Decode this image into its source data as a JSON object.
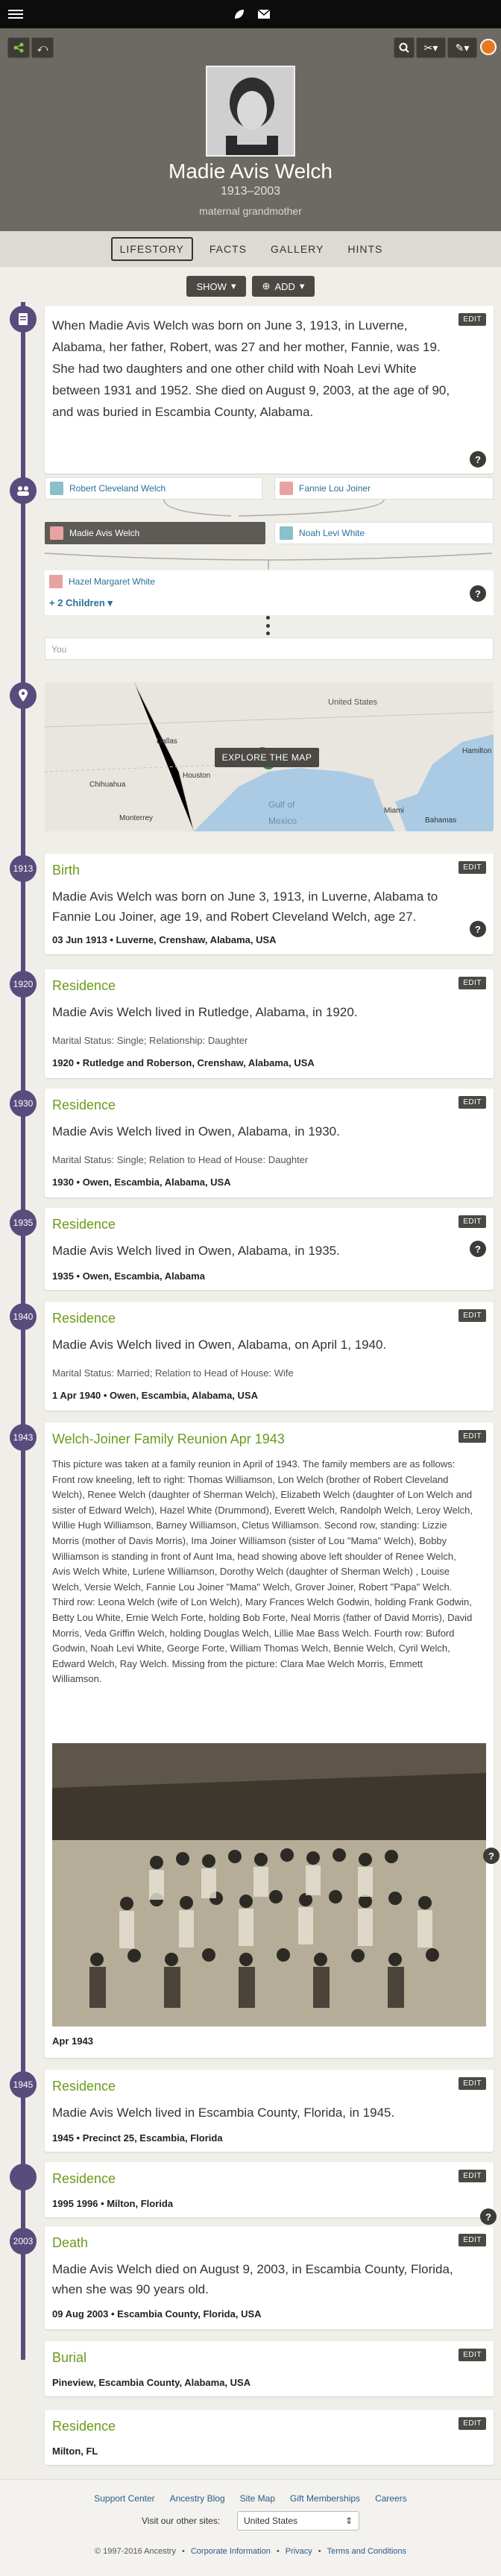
{
  "person": {
    "name": "Madie Avis Welch",
    "lifespan": "1913–2003",
    "relation": "maternal grandmother"
  },
  "tabs": [
    "LIFESTORY",
    "FACTS",
    "GALLERY",
    "HINTS"
  ],
  "actions": {
    "show": "SHOW",
    "add": "ADD"
  },
  "story": "When Madie Avis Welch was born on June 3, 1913, in Luverne, Alabama, her father, Robert, was 27 and her mother, Fannie, was 19. She had two daughters and one other child with Noah Levi White between 1931 and 1952. She died on August 9, 2003, at the age of 90, and was buried in Escambia County, Alabama.",
  "family": {
    "father": "Robert Cleveland Welch",
    "mother": "Fannie Lou Joiner",
    "self": "Madie Avis Welch",
    "spouse": "Noah Levi White",
    "child": "Hazel Margaret White",
    "more_children": "+ 2 Children",
    "you": "You"
  },
  "map": {
    "explore": "EXPLORE THE MAP",
    "labels": [
      "Dallas",
      "Houston",
      "Monterrey",
      "Chihuahua",
      "Hamilton",
      "Bahamas",
      "Gulf of",
      "Mexico",
      "United States",
      "Miami"
    ]
  },
  "edit_label": "EDIT",
  "events": [
    {
      "year": "1913",
      "title": "Birth",
      "sentence": "Madie Avis Welch was born on June 3, 1913, in Luverne, Alabama to Fannie Lou Joiner, age 19, and Robert Cleveland Welch, age 27.",
      "meta": "",
      "footer": "03 Jun 1913 • Luverne, Crenshaw, Alabama, USA"
    },
    {
      "year": "1920",
      "title": "Residence",
      "sentence": "Madie Avis Welch lived in Rutledge, Alabama, in 1920.",
      "meta": "Marital Status: Single; Relationship: Daughter",
      "footer": "1920 • Rutledge and Roberson, Crenshaw, Alabama, USA"
    },
    {
      "year": "1930",
      "title": "Residence",
      "sentence": "Madie Avis Welch lived in Owen, Alabama, in 1930.",
      "meta": "Marital Status: Single; Relation to Head of House: Daughter",
      "footer": "1930 • Owen, Escambia, Alabama, USA"
    },
    {
      "year": "1935",
      "title": "Residence",
      "sentence": "Madie Avis Welch lived in Owen, Alabama, in 1935.",
      "meta": "",
      "footer": "1935 • Owen, Escambia, Alabama"
    },
    {
      "year": "1940",
      "title": "Residence",
      "sentence": "Madie Avis Welch lived in Owen, Alabama, on April 1, 1940.",
      "meta": "Marital Status: Married; Relation to Head of House: Wife",
      "footer": "1 Apr 1940 • Owen, Escambia, Alabama, USA"
    }
  ],
  "reunion": {
    "year": "1943",
    "title": "Welch-Joiner Family Reunion Apr 1943",
    "description": "This picture was taken at a family reunion in April of 1943. The family members are as follows: Front row kneeling, left to right: Thomas Williamson, Lon Welch (brother of Robert Cleveland Welch), Renee Welch (daughter of Sherman Welch), Elizabeth Welch (daughter of Lon Welch and sister of Edward Welch), Hazel White (Drummond), Everett Welch, Randolph Welch, Leroy Welch, Willie Hugh Williamson, Barney Williamson, Cletus Williamson. Second row, standing: Lizzie Morris (mother of Davis Morris), Ima Joiner Williamson (sister of Lou \"Mama\" Welch), Bobby Williamson is standing in front of Aunt Ima, head showing above left shoulder of Renee Welch, Avis Welch White, Lurlene Williamson, Dorothy Welch (daughter of Sherman Welch) , Louise Welch, Versie Welch, Fannie Lou Joiner \"Mama\" Welch, Grover Joiner, Robert \"Papa\" Welch. Third row: Leona Welch (wife of Lon Welch), Mary Frances Welch Godwin, holding Frank Godwin, Betty Lou White, Ernie Welch Forte, holding Bob Forte, Neal Morris (father of David Morris), David Morris, Veda Griffin Welch, holding Douglas Welch, Lillie Mae Bass Welch. Fourth row: Buford Godwin, Noah Levi White, George Forte, William Thomas Welch, Bennie Welch, Cyril Welch, Edward Welch, Ray Welch. Missing from the picture: Clara Mae Welch Morris, Emmett Williamson.",
    "caption": "Apr 1943"
  },
  "events2": [
    {
      "year": "1945",
      "title": "Residence",
      "sentence": "Madie Avis Welch lived in Escambia County, Florida, in 1945.",
      "footer": "1945 • Precinct 25, Escambia, Florida"
    },
    {
      "year": "",
      "title": "Residence",
      "sentence": "",
      "footer": "1995 1996 • Milton, Florida"
    },
    {
      "year": "2003",
      "title": "Death",
      "sentence": "Madie Avis Welch died on August 9, 2003, in Escambia County, Florida, when she was 90 years old.",
      "footer": "09 Aug 2003 • Escambia County, Florida, USA"
    },
    {
      "year": "",
      "title": "Burial",
      "sentence": "",
      "footer": "Pineview, Escambia County, Alabama, USA"
    },
    {
      "year": "",
      "title": "Residence",
      "sentence": "",
      "footer": "Milton, FL"
    }
  ],
  "footer": {
    "links": [
      "Support Center",
      "Ancestry Blog",
      "Site Map",
      "Gift Memberships",
      "Careers"
    ],
    "other_sites": "Visit our other sites:",
    "country": "United States",
    "copyright": "© 1997-2016 Ancestry",
    "legal": [
      "Corporate Information",
      "Privacy",
      "Terms and Conditions"
    ]
  },
  "help_glyph": "?"
}
